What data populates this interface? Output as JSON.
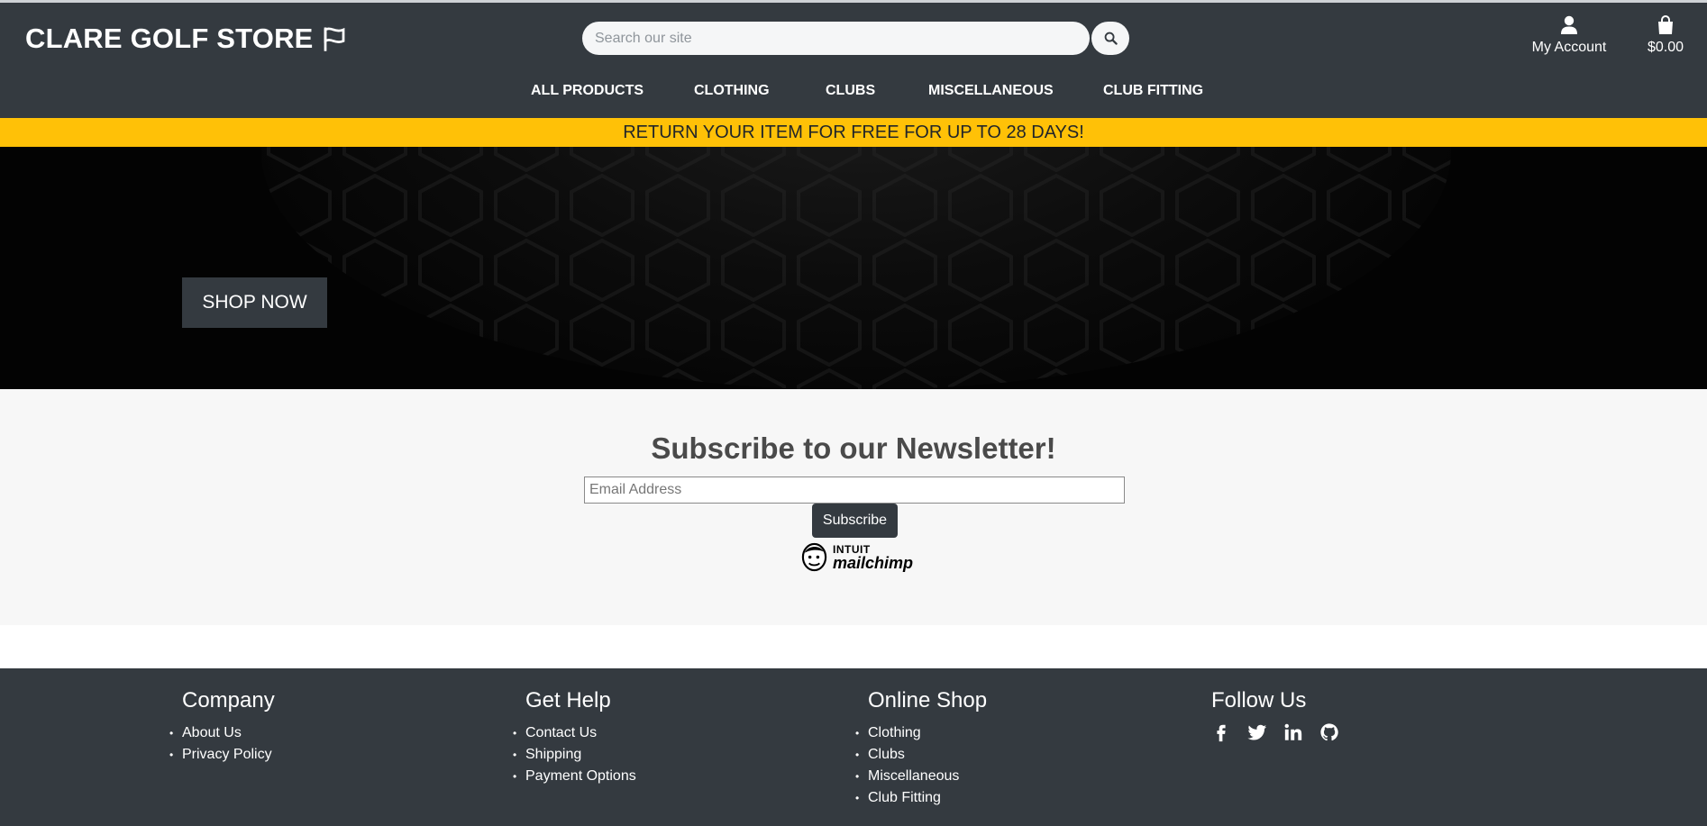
{
  "header": {
    "brand": "CLARE GOLF STORE",
    "search": {
      "placeholder": "Search our site"
    },
    "account_label": "My Account",
    "cart_total": "$0.00",
    "nav": [
      "ALL PRODUCTS",
      "CLOTHING",
      "CLUBS",
      "MISCELLANEOUS",
      "CLUB FITTING"
    ]
  },
  "banner": {
    "text": "RETURN YOUR ITEM FOR FREE FOR UP TO 28 DAYS!"
  },
  "hero": {
    "shop_now": "SHOP NOW"
  },
  "newsletter": {
    "title": "Subscribe to our Newsletter!",
    "email_placeholder": "Email Address",
    "subscribe_label": "Subscribe",
    "badge_top": "INTUIT",
    "badge_main": "mailchimp"
  },
  "footer": {
    "columns": [
      {
        "title": "Company",
        "links": [
          "About Us",
          "Privacy Policy"
        ]
      },
      {
        "title": "Get Help",
        "links": [
          "Contact Us",
          "Shipping",
          "Payment Options"
        ]
      },
      {
        "title": "Online Shop",
        "links": [
          "Clothing",
          "Clubs",
          "Miscellaneous",
          "Club Fitting"
        ]
      },
      {
        "title": "Follow Us",
        "social": [
          "facebook-icon",
          "twitter-icon",
          "linkedin-icon",
          "github-icon"
        ]
      }
    ]
  },
  "colors": {
    "header_bg": "#343a40",
    "banner_bg": "#ffc107",
    "newsletter_bg": "#f7f7f7",
    "footer_bg": "#343a40"
  }
}
